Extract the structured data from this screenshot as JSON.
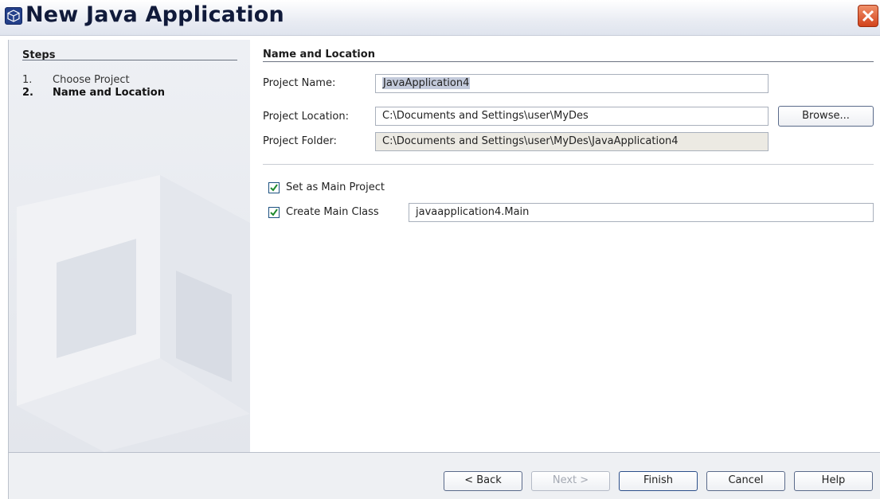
{
  "window": {
    "title": "New Java Application",
    "app_icon": "netbeans-cube-icon",
    "close_icon": "close-x-icon"
  },
  "steps": {
    "heading": "Steps",
    "items": [
      {
        "num": "1.",
        "label": "Choose Project",
        "current": false
      },
      {
        "num": "2.",
        "label": "Name and Location",
        "current": true
      }
    ]
  },
  "section": {
    "heading": "Name and Location"
  },
  "form": {
    "project_name_label": "Project Name:",
    "project_name_value": "JavaApplication4",
    "project_location_label": "Project Location:",
    "project_location_value": "C:\\Documents and Settings\\user\\MyDes",
    "browse_label": "Browse...",
    "project_folder_label": "Project Folder:",
    "project_folder_value": "C:\\Documents and Settings\\user\\MyDes\\JavaApplication4",
    "set_main_project_label": "Set as Main Project",
    "set_main_project_checked": true,
    "create_main_class_label": "Create Main Class",
    "create_main_class_checked": true,
    "main_class_value": "javaapplication4.Main"
  },
  "buttons": {
    "back": "< Back",
    "next": "Next >",
    "finish": "Finish",
    "cancel": "Cancel",
    "help": "Help"
  },
  "colors": {
    "close_button": "#d2431b",
    "checkmark": "#1f8a2e",
    "panel_bg": "#e3e6ec"
  }
}
